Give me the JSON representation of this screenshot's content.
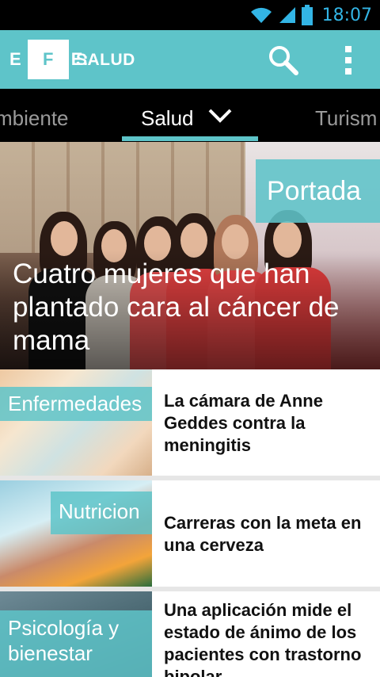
{
  "status": {
    "time": "18:07"
  },
  "appbar": {
    "logo_text": "EFE:",
    "section": "SALUD"
  },
  "tabs": [
    {
      "label": "mbiente"
    },
    {
      "label": "Salud"
    },
    {
      "label": "Turism"
    }
  ],
  "hero": {
    "tag": "Portada",
    "title": "Cuatro mujeres que han plantado cara al cáncer de mama"
  },
  "articles": [
    {
      "category": "Enfermedades",
      "title": "La cámara de Anne Geddes contra la meningitis"
    },
    {
      "category": "Nutricion",
      "title": "Carreras con la meta en una cerveza"
    },
    {
      "category": "Psicología y bienestar",
      "title": "Una aplicación mide el estado de ánimo de los pacientes con trastorno bipolar"
    }
  ],
  "colors": {
    "accent": "#5ec4c9",
    "status_blue": "#33b5e5"
  }
}
